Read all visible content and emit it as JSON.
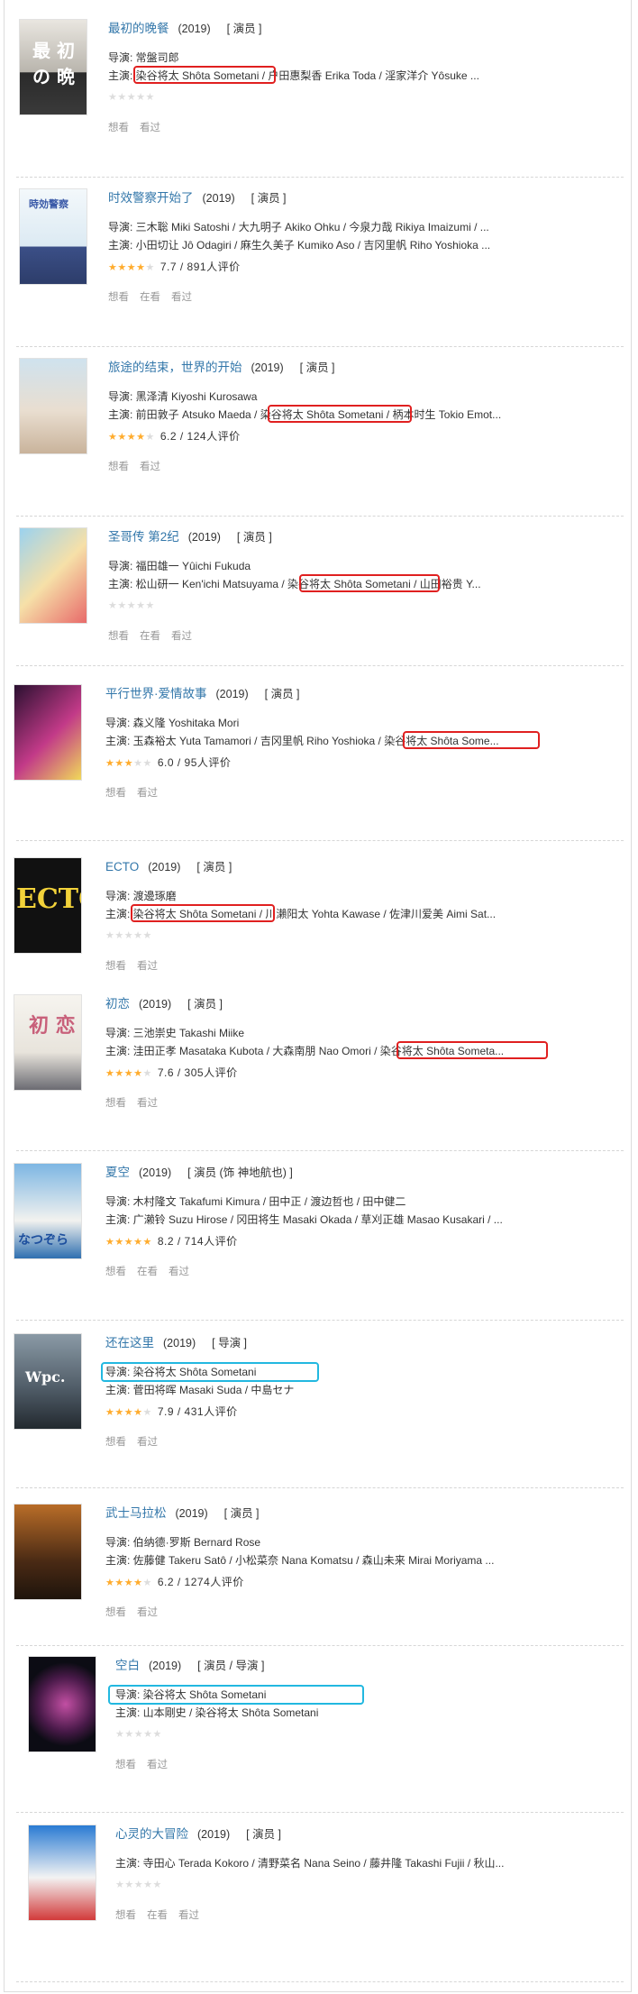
{
  "colors": {
    "title": "#3377aa",
    "star": "#ffac2d",
    "red_box": "#e02020",
    "blue_box": "#22b8e0"
  },
  "items": [
    {
      "title": "最初的晚餐",
      "year": "(2019)",
      "role": "[ 演员 ]",
      "director": "导演: 常盤司郎",
      "cast_prefix": "主演: ",
      "cast_hl": "染谷将太 Shôta Sometani",
      "cast_rest": " / 户田惠梨香 Erika Toda / 淫家洋介 Yôsuke ...",
      "rating": "",
      "stars": 0,
      "actions": [
        "想看",
        "看过"
      ],
      "poster": "最 初 の 晩"
    },
    {
      "title": "时效警察开始了",
      "year": "(2019)",
      "role": "[ 演员 ]",
      "director": "导演: 三木聡 Miki Satoshi / 大九明子 Akiko Ohku / 今泉力哉 Rikiya Imaizumi / ...",
      "cast_prefix": "主演: 小田切让 Jô Odagiri / 麻生久美子 Kumiko Aso / 吉冈里帆 Riho Yoshioka ...",
      "cast_hl": "",
      "cast_rest": "",
      "rating": "7.7 / 891人评价",
      "stars": 4,
      "actions": [
        "想看",
        "在看",
        "看过"
      ],
      "poster": "時効警察"
    },
    {
      "title": "旅途的结束，世界的开始",
      "year": "(2019)",
      "role": "[ 演员 ]",
      "director": "导演: 黑泽清 Kiyoshi Kurosawa",
      "cast_prefix": "主演: 前田敦子 Atsuko Maeda / ",
      "cast_hl": "染谷将太 Shôta Sometani",
      "cast_rest": " / 柄本时生 Tokio Emot...",
      "rating": "6.2 / 124人评价",
      "stars": 3.5,
      "actions": [
        "想看",
        "看过"
      ],
      "poster": ""
    },
    {
      "title": "圣哥传 第2纪",
      "year": "(2019)",
      "role": "[ 演员 ]",
      "director": "导演: 福田雄一 Yûichi Fukuda",
      "cast_prefix": "主演: 松山研一 Ken'ichi Matsuyama / ",
      "cast_hl": "染谷将太 Shôta Sometani",
      "cast_rest": " / 山田裕贵 Y...",
      "rating": "",
      "stars": 0,
      "actions": [
        "想看",
        "在看",
        "看过"
      ],
      "poster": ""
    },
    {
      "title": "平行世界·爱情故事",
      "year": "(2019)",
      "role": "[ 演员 ]",
      "director": "导演: 森义隆 Yoshitaka Mori",
      "cast_prefix": "主演: 玉森裕太 Yuta Tamamori / 吉冈里帆 Riho Yoshioka / ",
      "cast_hl": "染谷将太 Shôta Some...",
      "cast_rest": "",
      "rating": "6.0 / 95人评价",
      "stars": 3,
      "actions": [
        "想看",
        "看过"
      ],
      "poster": ""
    },
    {
      "title": "ECTO",
      "year": "(2019)",
      "role": "[ 演员 ]",
      "director": "导演: 渡邊琢磨",
      "cast_prefix": "主演: ",
      "cast_hl": "染谷将太 Shôta Sometani",
      "cast_rest": " / 川瀨阳太 Yohta Kawase / 佐津川爱美 Aimi Sat...",
      "rating": "",
      "stars": 0,
      "actions": [
        "想看",
        "看过"
      ],
      "poster": "ECTO"
    },
    {
      "title": "初恋",
      "year": "(2019)",
      "role": "[ 演员 ]",
      "director": "导演: 三池崇史 Takashi Miike",
      "cast_prefix": "主演: 洼田正孝 Masataka Kubota / 大森南朋 Nao Omori / ",
      "cast_hl": "染谷将太 Shôta Someta...",
      "cast_rest": "",
      "rating": "7.6 / 305人评价",
      "stars": 4,
      "actions": [
        "想看",
        "看过"
      ],
      "poster": "初 恋"
    },
    {
      "title": "夏空",
      "year": "(2019)",
      "role": "[ 演员 (饰 神地航也) ]",
      "director": "导演: 木村隆文 Takafumi Kimura / 田中正 / 渡边哲也 / 田中健二",
      "cast_prefix": "主演: 广濑铃 Suzu Hirose / 冈田将生 Masaki Okada / 草刈正雄 Masao Kusakari / ...",
      "cast_hl": "",
      "cast_rest": "",
      "rating": "8.2 / 714人评价",
      "stars": 4.5,
      "actions": [
        "想看",
        "在看",
        "看过"
      ],
      "poster": "なつぞら"
    },
    {
      "title": "还在这里",
      "year": "(2019)",
      "role": "[ 导演 ]",
      "director": "导演: 染谷将太 Shôta Sometani",
      "cast_prefix": "主演: 菅田将晖 Masaki Suda / 中島セナ",
      "cast_hl": "",
      "cast_rest": "",
      "rating": "7.9 / 431人评价",
      "stars": 4,
      "actions": [
        "想看",
        "看过"
      ],
      "poster": "Wpc."
    },
    {
      "title": "武士马拉松",
      "year": "(2019)",
      "role": "[ 演员 ]",
      "director": "导演: 伯纳德·罗斯 Bernard Rose",
      "cast_prefix": "主演: 佐藤健 Takeru Satô / 小松菜奈 Nana Komatsu / 森山未来 Mirai Moriyama ...",
      "cast_hl": "",
      "cast_rest": "",
      "rating": "6.2 / 1274人评价",
      "stars": 3.5,
      "actions": [
        "想看",
        "看过"
      ],
      "poster": ""
    },
    {
      "title": "空白",
      "year": "(2019)",
      "role": "[ 演员 / 导演 ]",
      "director": "导演: 染谷将太 Shôta Sometani",
      "cast_prefix": "主演: 山本剛史 / 染谷将太 Shôta Sometani",
      "cast_hl": "",
      "cast_rest": "",
      "rating": "",
      "stars": 0,
      "actions": [
        "想看",
        "看过"
      ],
      "poster": ""
    },
    {
      "title": "心灵的大冒险",
      "year": "(2019)",
      "role": "[ 演员 ]",
      "director": "主演: 寺田心 Terada Kokoro / 清野菜名 Nana Seino / 藤井隆 Takashi Fujii / 秋山...",
      "cast_prefix": "",
      "cast_hl": "",
      "cast_rest": "",
      "rating": "",
      "stars": 0,
      "actions": [
        "想看",
        "在看",
        "看过"
      ],
      "poster": ""
    }
  ]
}
